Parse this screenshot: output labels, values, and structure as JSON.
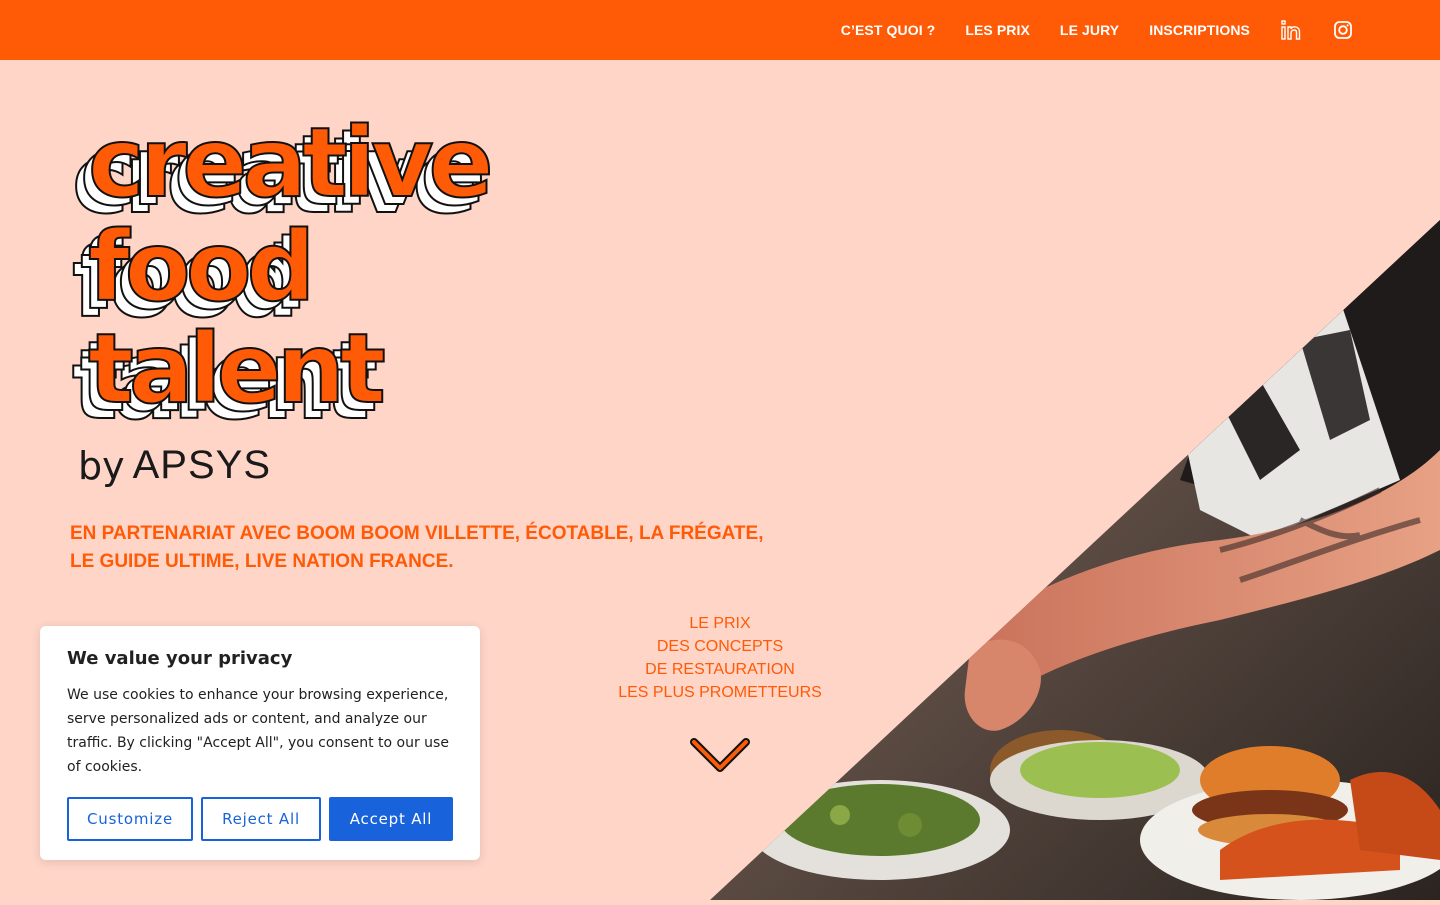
{
  "nav": {
    "links": [
      "C’EST QUOI ?",
      "LES PRIX",
      "LE JURY",
      "INSCRIPTIONS"
    ],
    "icons": [
      "linkedin-icon",
      "instagram-icon"
    ]
  },
  "logo": {
    "lines": [
      "creative",
      "food",
      "talent"
    ],
    "by": "by",
    "brand": "APSYS"
  },
  "partner": {
    "line1": "EN PARTENARIAT AVEC BOOM BOOM VILLETTE, ÉCOTABLE, LA FRÉGATE,",
    "line2": "LE GUIDE ULTIME, LIVE NATION FRANCE."
  },
  "tagline": [
    "LE PRIX",
    "DES CONCEPTS",
    "DE RESTAURATION",
    "LES PLUS PROMETTEURS"
  ],
  "cookie": {
    "title": "We value your privacy",
    "text": "We use cookies to enhance your browsing experience, serve personalized ads or content, and analyze our traffic. By clicking \"Accept All\", you consent to our use of cookies.",
    "customize_label": "Customize",
    "reject_label": "Reject All",
    "accept_label": "Accept All"
  },
  "colors": {
    "accent": "#ff5a06",
    "background": "#ffd5c8",
    "cookie_button": "#1863dc"
  }
}
